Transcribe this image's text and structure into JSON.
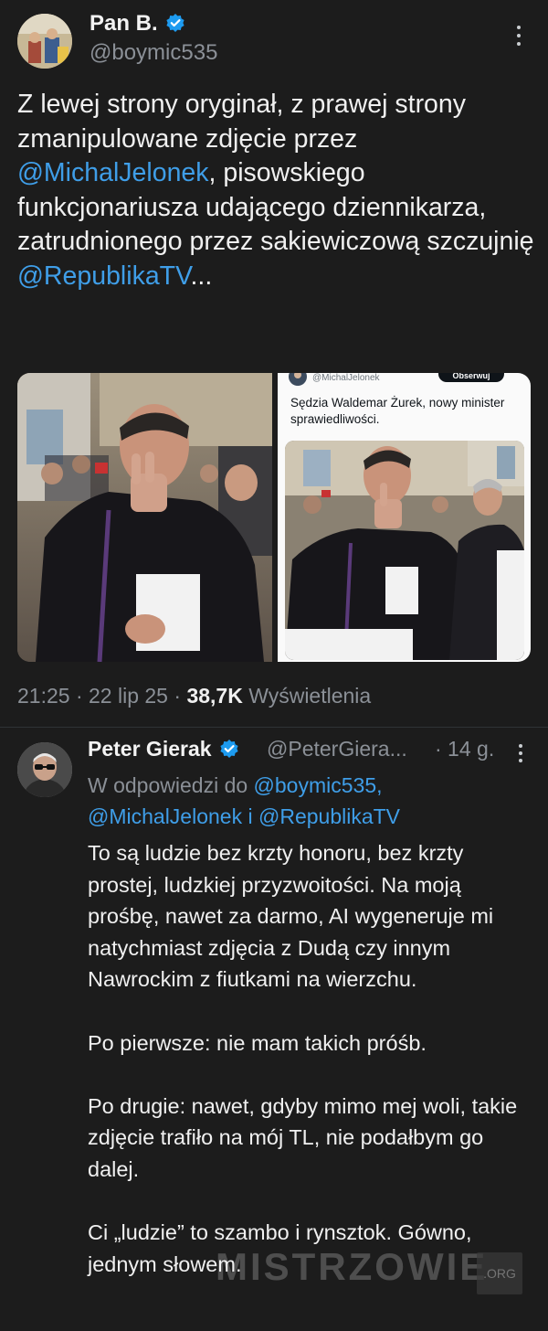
{
  "main_tweet": {
    "author_name": "Pan B.",
    "author_handle": "@boymic535",
    "text_parts": {
      "p1": "Z lewej strony oryginał, z prawej strony zmanipulowane zdjęcie przez ",
      "mention1": "@MichalJelonek",
      "p2": ", pisowskiego funkcjonariusza udającego dziennikarza, zatrudnionego przez sakiewiczową szczujnię ",
      "mention2": "@RepublikaTV",
      "p3": "..."
    },
    "embedded_screenshot": {
      "handle": "@MichalJelonek",
      "follow_label": "Obserwuj",
      "text": "Sędzia Waldemar Żurek, nowy minister sprawiedliwości."
    },
    "time": "21:25",
    "date": "22 lip 25",
    "views_count": "38,7K",
    "views_label": "Wyświetlenia",
    "separator": "·"
  },
  "reply": {
    "author_name": "Peter Gierak",
    "author_handle": "@PeterGiera...",
    "age": "· 14 g.",
    "reply_to_label": "W odpowiedzi do",
    "reply_to_mention1": "@boymic535,",
    "reply_to_mention2": "@MichalJelonek",
    "reply_to_and": " i ",
    "reply_to_mention3": "@RepublikaTV",
    "paragraphs": [
      "To są ludzie bez krzty honoru, bez krzty prostej, ludzkiej przyzwoitości. Na moją prośbę, nawet za darmo, AI wygeneruje mi natychmiast zdjęcia z Dudą czy innym Nawrockim z fiutkami na wierzchu.",
      "Po pierwsze: nie mam takich próśb.",
      "Po drugie: nawet, gdyby mimo mej woli, takie zdjęcie trafiło na mój TL, nie podałbym go dalej.",
      "Ci „ludzie” to szambo i rynsztok. Gówno, jednym słowem."
    ]
  },
  "watermark": {
    "text": "MISTRZOWIE",
    "badge": ".ORG"
  },
  "icons": {
    "verified": "verified-badge-icon",
    "more": "more-options-icon"
  },
  "colors": {
    "background": "#1c1c1c",
    "link": "#3f9ee8",
    "muted": "#8b9097",
    "verified": "#1d9bf0"
  }
}
